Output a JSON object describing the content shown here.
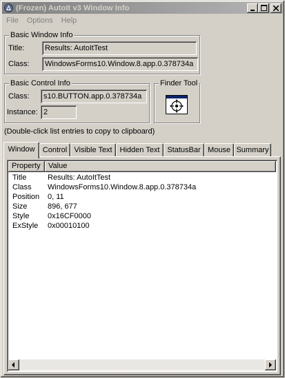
{
  "window": {
    "title": "(Frozen) AutoIt v3 Window Info",
    "icon": "autoit-icon",
    "controls": [
      "minimize-icon",
      "maximize-icon",
      "close-icon"
    ]
  },
  "menu": {
    "items": [
      "File",
      "Options",
      "Help"
    ]
  },
  "basic_window": {
    "heading": "Basic Window Info",
    "title_label": "Title:",
    "title_value": "Results: AutoItTest",
    "class_label": "Class:",
    "class_value": "WindowsForms10.Window.8.app.0.378734a"
  },
  "basic_control": {
    "heading": "Basic Control Info",
    "class_label": "Class:",
    "class_value": "s10.BUTTON.app.0.378734a",
    "instance_label": "Instance:",
    "instance_value": "2"
  },
  "finder": {
    "heading": "Finder Tool",
    "icon": "crosshair-icon"
  },
  "hint": "(Double-click list entries to copy to clipboard)",
  "tabs": [
    "Window",
    "Control",
    "Visible Text",
    "Hidden Text",
    "StatusBar",
    "Mouse",
    "Summary"
  ],
  "active_tab": "Window",
  "list": {
    "columns": [
      "Property",
      "Value"
    ],
    "rows": [
      {
        "property": "Title",
        "value": "Results: AutoItTest"
      },
      {
        "property": "Class",
        "value": "WindowsForms10.Window.8.app.0.378734a"
      },
      {
        "property": "Position",
        "value": "0, 11"
      },
      {
        "property": "Size",
        "value": "896, 677"
      },
      {
        "property": "Style",
        "value": "0x16CF0000"
      },
      {
        "property": "ExStyle",
        "value": "0x00010100"
      }
    ]
  }
}
